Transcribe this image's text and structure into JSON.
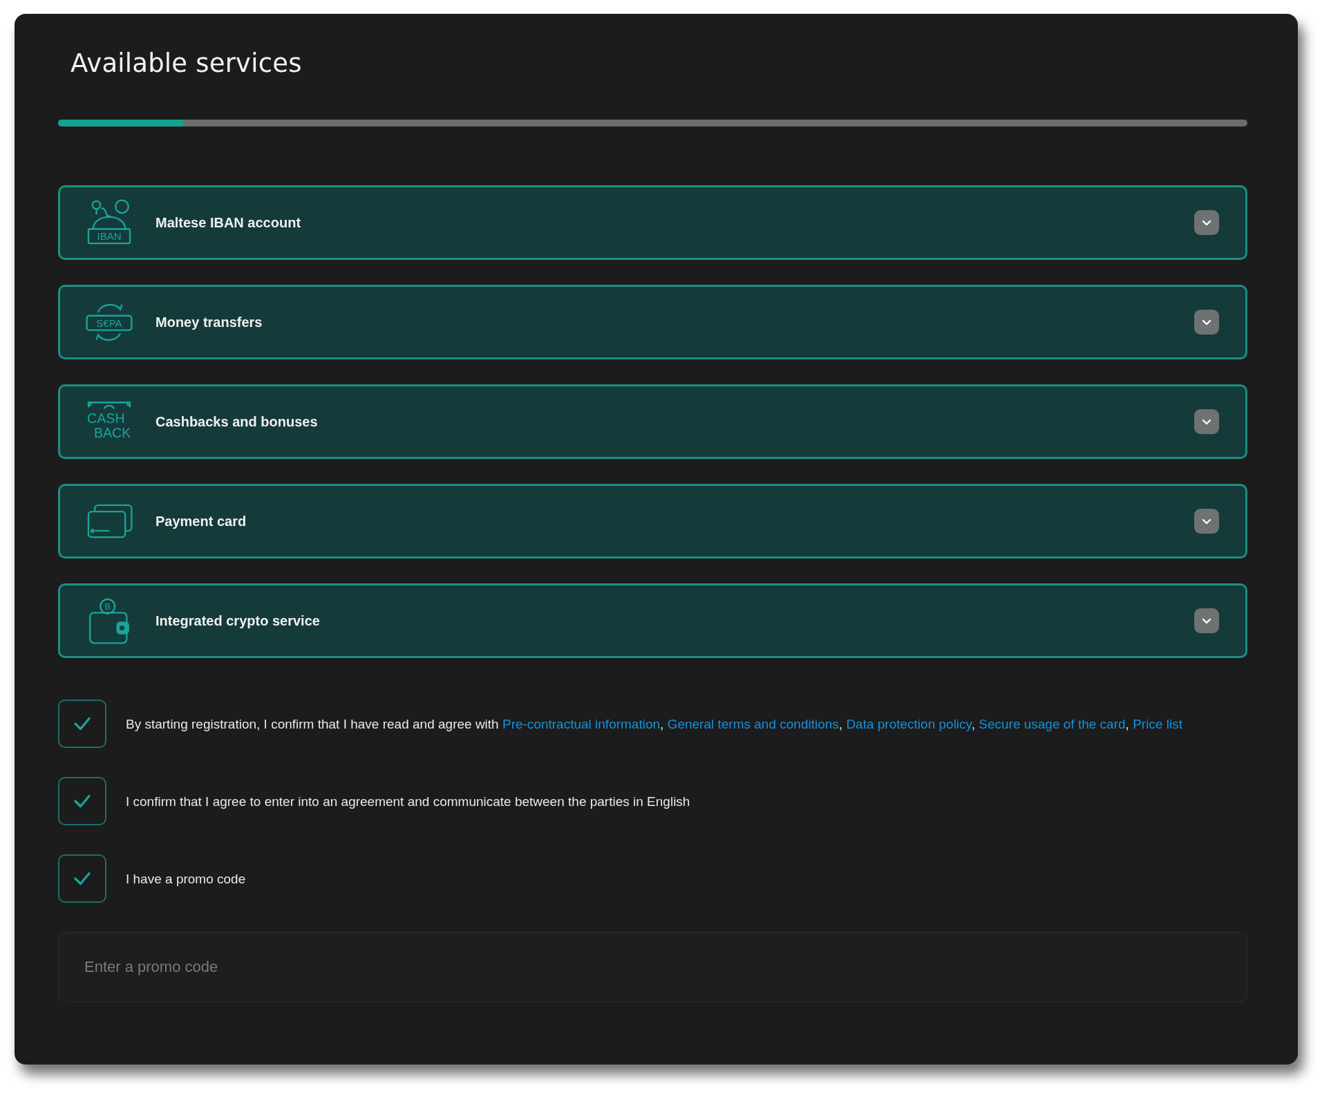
{
  "title": "Available services",
  "progress": {
    "level": 0.105
  },
  "services": [
    {
      "kind": "iban",
      "icon_label": [
        "IBAN"
      ],
      "label": "Maltese IBAN account",
      "expanded": false
    },
    {
      "kind": "sepa",
      "icon_label": [
        "S€PA"
      ],
      "label": "Money transfers",
      "expanded": false
    },
    {
      "kind": "cashback",
      "icon_label": [
        "CASH",
        "BACK"
      ],
      "label": "Cashbacks and bonuses",
      "expanded": false
    },
    {
      "kind": "card",
      "label": "Payment card",
      "expanded": false
    },
    {
      "kind": "crypto",
      "icon_label": [
        "B"
      ],
      "label": "Integrated crypto service",
      "expanded": false
    }
  ],
  "agreements": [
    {
      "checked": true,
      "parts": [
        {
          "kind": "text",
          "text": "By starting registration, I confirm that I have read and agree with "
        },
        {
          "kind": "link",
          "text": "Pre-contractual information"
        },
        {
          "kind": "text",
          "text": ", "
        },
        {
          "kind": "link",
          "text": "General terms and conditions"
        },
        {
          "kind": "text",
          "text": ", "
        },
        {
          "kind": "link",
          "text": "Data protection policy"
        },
        {
          "kind": "text",
          "text": ", "
        },
        {
          "kind": "link",
          "text": "Secure usage of the card"
        },
        {
          "kind": "text",
          "text": ", "
        },
        {
          "kind": "link",
          "text": "Price list"
        }
      ]
    },
    {
      "checked": true,
      "parts": [
        {
          "kind": "text",
          "text": "I confirm that I agree to enter into an agreement and communicate between the parties in English"
        }
      ]
    },
    {
      "checked": true,
      "parts": [
        {
          "kind": "text",
          "text": "I have a promo code"
        }
      ]
    }
  ],
  "promo": {
    "placeholder": "Enter a promo code"
  }
}
